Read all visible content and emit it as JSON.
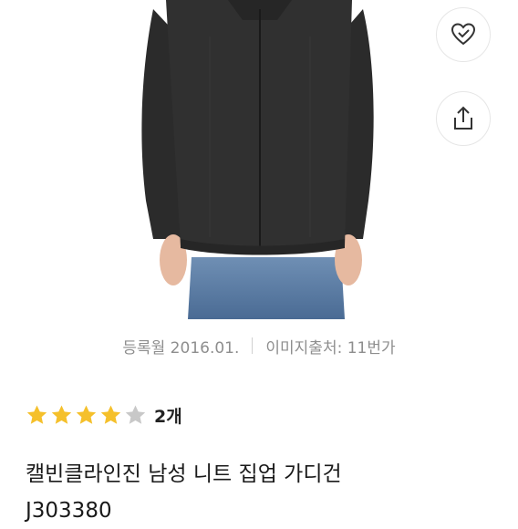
{
  "product": {
    "registered_date": "등록월 2016.01.",
    "image_source": "이미지출처: 11번가",
    "rating_stars": 4,
    "rating_max": 5,
    "review_count": "2개",
    "title_line1": "캘빈클라인진 남성 니트 집업 가디건",
    "title_line2": "J303380"
  },
  "actions": {
    "like_icon": "heart-check-icon",
    "share_icon": "share-icon"
  },
  "colors": {
    "star_filled": "#f5c02b",
    "star_empty": "#c8c8c8",
    "meta_text": "#8e8e8e"
  }
}
